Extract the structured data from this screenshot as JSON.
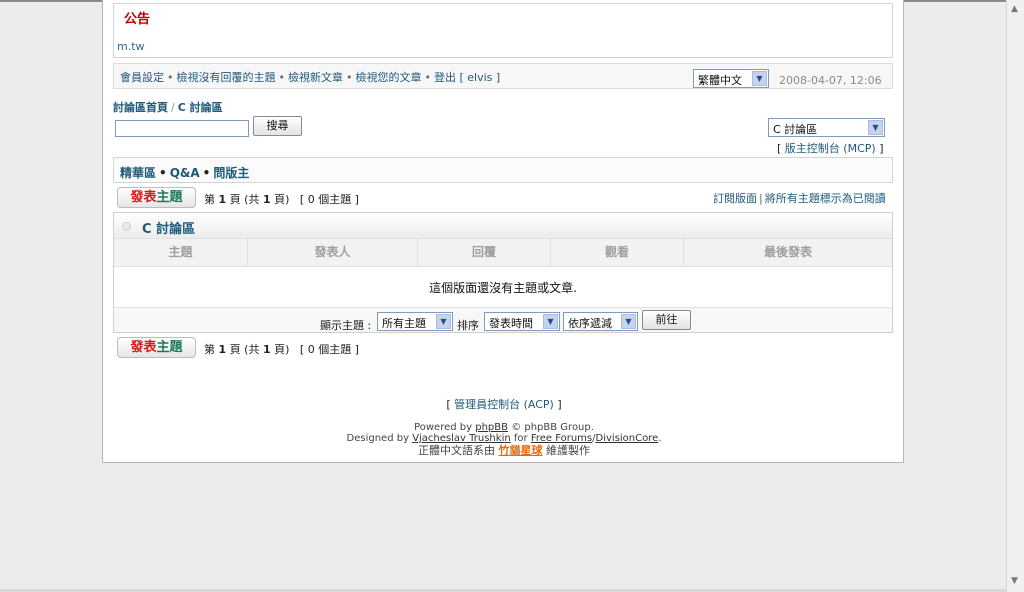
{
  "announcement": {
    "title": "公告",
    "text": "m.tw"
  },
  "navbar": {
    "links": [
      "會員設定",
      "檢視沒有回覆的主題",
      "檢視新文章",
      "檢視您的文章",
      "登出 [ elvis ]"
    ],
    "separator": "•",
    "language": "繁體中文",
    "datetime": "2008-04-07, 12:06"
  },
  "breadcrumb": {
    "home": "討論區首頁",
    "separator": "/",
    "current": "C 討論區"
  },
  "search": {
    "value": "",
    "button": "搜尋"
  },
  "forum_jump": {
    "selected": "C 討論區"
  },
  "mcp": {
    "open": "[",
    "label": "版主控制台 (MCP)",
    "close": "]"
  },
  "subnav": {
    "items": [
      "精華區",
      "Q&A",
      "問版主"
    ],
    "separator": "•"
  },
  "post_button": {
    "part1": "發表",
    "part2": "主題"
  },
  "pagination": {
    "prefix": "第",
    "page": "1",
    "middle": "頁 (共",
    "total": "1",
    "suffix": "頁)",
    "topic_count": "[ 0 個主題 ]"
  },
  "right_links": {
    "subscribe": "訂閱版面",
    "separator": "|",
    "mark_read": "將所有主題標示為已閱讀"
  },
  "forum": {
    "title": "C 討論區",
    "columns": [
      "主題",
      "發表人",
      "回覆",
      "觀看",
      "最後發表"
    ],
    "empty_message": "這個版面還沒有主題或文章."
  },
  "filter": {
    "display_label": "顯示主題 :",
    "display_value": "所有主題",
    "sort_label": "排序",
    "sort_value": "發表時間",
    "order_value": "依序遞減",
    "go_button": "前往"
  },
  "footer": {
    "acp_open": "[",
    "acp_label": "管理員控制台 (ACP)",
    "acp_close": "]",
    "powered_prefix": "Powered by",
    "powered_link": "phpBB",
    "powered_suffix": "© phpBB Group.",
    "designed_prefix": "Designed by",
    "designer": "Vjacheslav Trushkin",
    "for_text": "for",
    "free_forums": "Free Forums",
    "slash": "/",
    "division_core": "DivisionCore",
    "period": ".",
    "translation_prefix": "正體中文語系由",
    "translator": "竹貓星球",
    "translation_suffix": "維護製作"
  },
  "colors": {
    "link": "#1e5a7a",
    "announce_title": "#c00000",
    "post_red": "#d81818",
    "post_green": "#1e7a5a"
  }
}
